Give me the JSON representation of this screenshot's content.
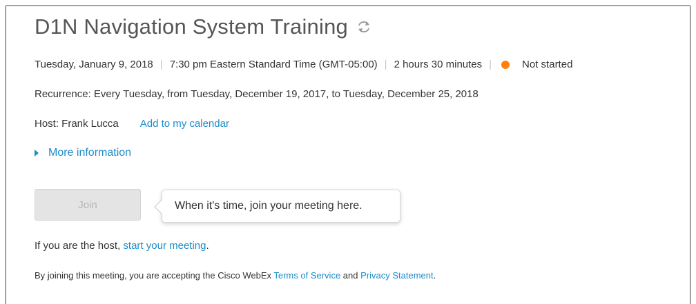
{
  "meeting": {
    "title": "D1N Navigation System Training",
    "recurrence_icon": "recurrence-icon",
    "date": "Tuesday, January 9, 2018",
    "time": "7:30 pm Eastern Standard Time (GMT-05:00)",
    "duration": "2 hours 30 minutes",
    "status": "Not started",
    "status_color": "#ff7f0f",
    "separator": "|",
    "recurrence": "Recurrence: Every Tuesday, from Tuesday, December 19, 2017, to Tuesday, December 25, 2018",
    "host_label": "Host: Frank Lucca",
    "add_calendar_link": "Add to my calendar",
    "more_info_link": "More information"
  },
  "join": {
    "button_label": "Join",
    "tooltip": "When it's time, join your meeting here."
  },
  "host_start": {
    "prefix": "If you are the host, ",
    "link": "start your meeting",
    "suffix": "."
  },
  "terms": {
    "prefix": "By joining this meeting, you are accepting the Cisco WebEx ",
    "tos_link": "Terms of Service",
    "middle": " and ",
    "privacy_link": "Privacy Statement",
    "suffix": "."
  },
  "colors": {
    "link": "#1a8cc9",
    "title": "#555555",
    "text": "#333333",
    "join_disabled_bg": "#e4e4e4"
  }
}
